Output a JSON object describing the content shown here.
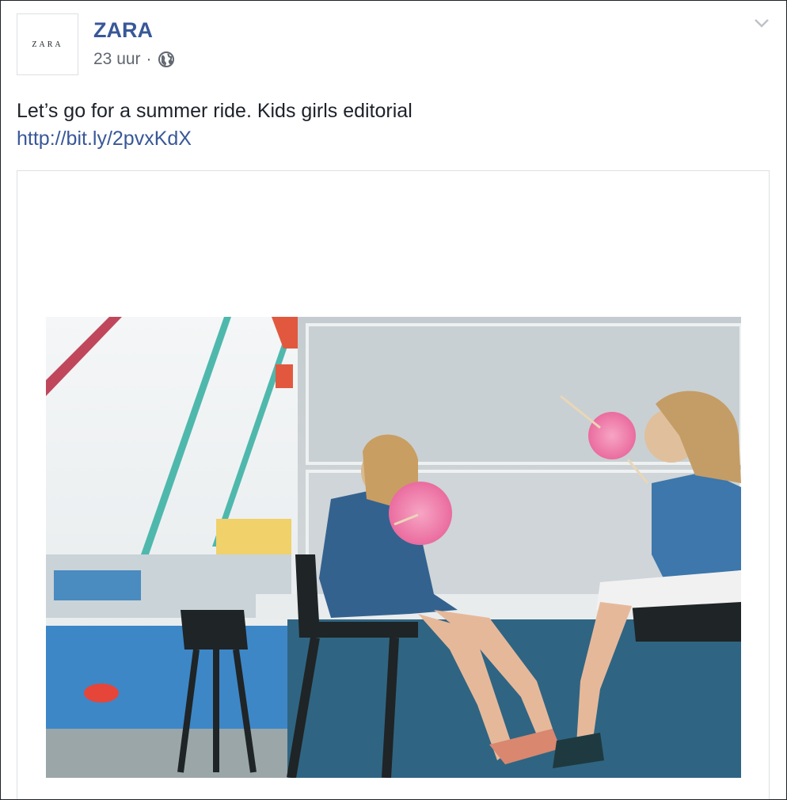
{
  "post": {
    "avatar_text": "ZARA",
    "page_name": "ZARA",
    "timestamp": "23 uur",
    "separator": "·",
    "audience_icon": "globe-icon",
    "menu_icon": "chevron-down-icon",
    "text": "Let’s go for a summer ride. Kids girls editorial",
    "link": "http://bit.ly/2pvxKdX"
  },
  "colors": {
    "name_link": "#385898",
    "text": "#1d2129",
    "meta": "#616770",
    "border": "#dddfe2"
  }
}
